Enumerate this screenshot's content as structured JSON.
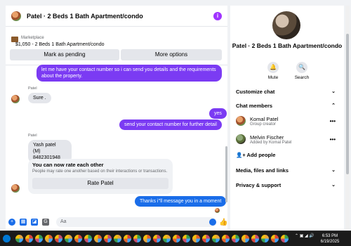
{
  "header": {
    "title": "Patel · 2 Beds 1 Bath Apartment/condo",
    "info_icon": "i"
  },
  "listing": {
    "label": "Marketplace",
    "detail": "$1,050 - 2 Beds 1 Bath Apartment/condo",
    "mark_pending": "Mark as pending",
    "more_options": "More options"
  },
  "messages": {
    "m1": "let me have your contact number so i can send you details and the requirements about the property.",
    "sender1": "Patel",
    "m2": "Sure .",
    "m3": "yes",
    "m4": "send your contact number for further detail",
    "sender2": "Patel",
    "m5_line1": "Yash patel",
    "m5_line2": "(M) 8482301948",
    "rate_title": "You can now rate each other",
    "rate_sub": "People may rate one another based on their interactions or transactions.",
    "rate_button": "Rate Patel",
    "m6": "Thanks i''ll message you in a moment"
  },
  "composer": {
    "placeholder": "Aa"
  },
  "right_panel": {
    "title": "Patel · 2 Beds 1 Bath Apartment/condo",
    "mute": "Mute",
    "search": "Search",
    "customize_chat": "Customize chat",
    "chat_members": "Chat members",
    "members": [
      {
        "name": "Komal Patel",
        "role": "Group creator"
      },
      {
        "name": "Melvin Fischer",
        "role": "Added by Komal Patel"
      }
    ],
    "add_people": "Add people",
    "media": "Media, files and links",
    "privacy": "Privacy & support"
  },
  "taskbar": {
    "time": "6:53 PM",
    "date": "6/19/2025"
  },
  "colors": {
    "accent_purple": "#7b3bf3",
    "accent_blue": "#1a6de9",
    "bubble_in": "#e4e6eb"
  }
}
